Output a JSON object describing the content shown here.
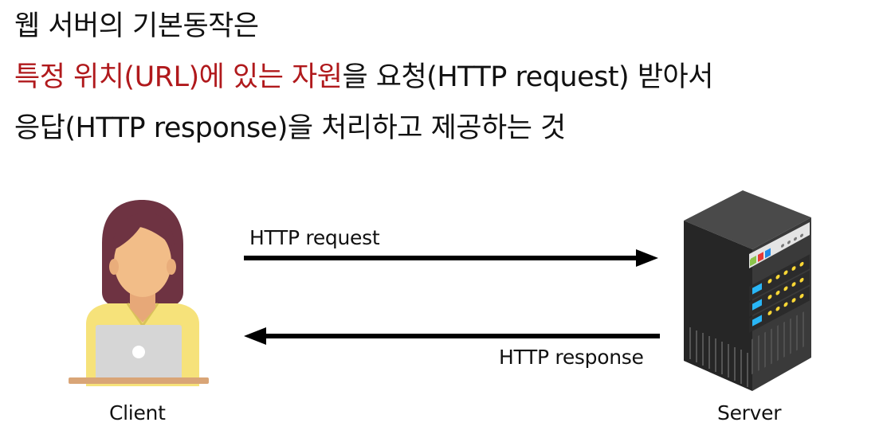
{
  "headline": {
    "line1": "웹 서버의 기본동작은",
    "line2_highlight": "특정 위치(URL)에 있는 자원",
    "line2_rest": "을 요청(HTTP request) 받아서",
    "line3": "응답(HTTP response)을 처리하고 제공하는 것",
    "highlight_color": "#b0191c"
  },
  "diagram": {
    "request_label": "HTTP request",
    "response_label": "HTTP response",
    "client_label": "Client",
    "server_label": "Server"
  }
}
